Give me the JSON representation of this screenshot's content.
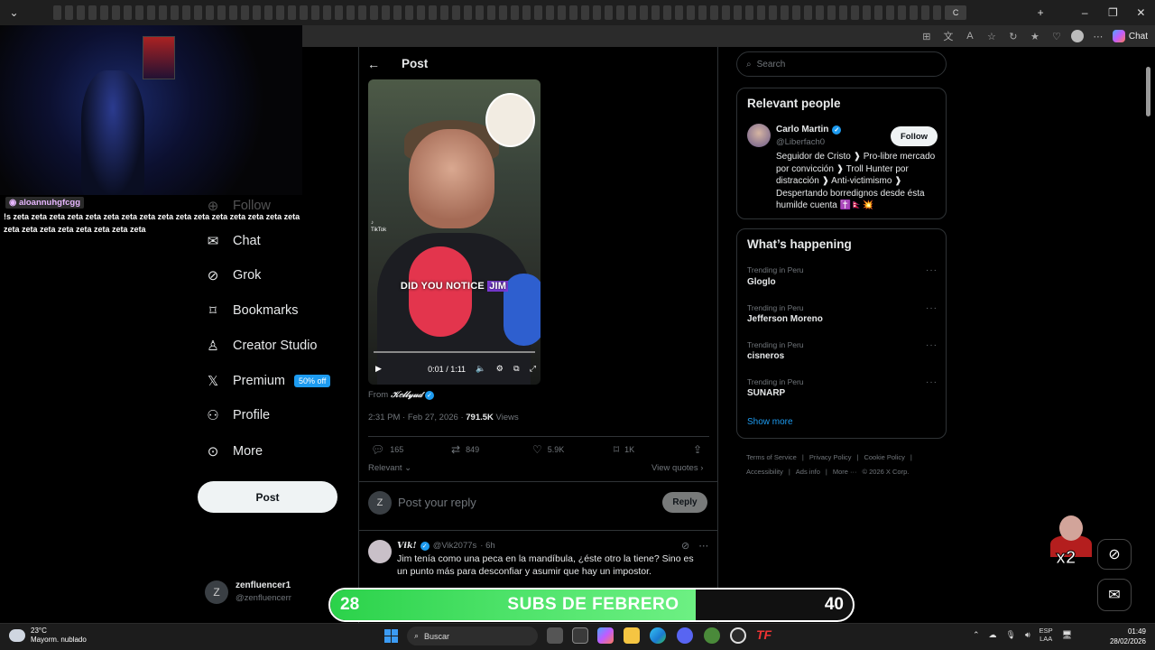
{
  "browser": {
    "active_tab_label": "C",
    "chat_label": "Chat"
  },
  "stream_overlay": {
    "chat_username": "aloannuhgfcgg",
    "chat_message": "!s zeta zeta zeta zeta zeta zeta zeta zeta zeta zeta zeta zeta zeta zeta zeta zeta zeta zeta zeta zeta zeta zeta zeta zeta",
    "subs_current": "28",
    "subs_label": "SUBS DE FEBRERO",
    "subs_goal": "40",
    "subs_progress": 0.7,
    "multiplier": "x2"
  },
  "nav": {
    "items": [
      {
        "label": "Follow",
        "icon": "add-user-icon"
      },
      {
        "label": "Chat",
        "icon": "mail-icon"
      },
      {
        "label": "Grok",
        "icon": "grok-icon"
      },
      {
        "label": "Bookmarks",
        "icon": "bookmark-icon"
      },
      {
        "label": "Creator Studio",
        "icon": "creator-icon"
      },
      {
        "label": "Premium",
        "icon": "x-logo-icon"
      },
      {
        "label": "Profile",
        "icon": "person-icon"
      },
      {
        "label": "More",
        "icon": "more-circle-icon"
      }
    ],
    "premium_badge": "50% off",
    "post_button": "Post",
    "account": {
      "avatar_letter": "Z",
      "name": "zenfluencer1",
      "handle": "@zenfluencerr"
    }
  },
  "post": {
    "header": "Post",
    "video": {
      "caption_before": "DID YOU NOTICE",
      "caption_highlight": "JIM",
      "tiktok_label": "TikTok",
      "time": "0:01 / 1:11"
    },
    "from_label": "From",
    "from_name": "𝒦𝑒𝓁𝓁𝓎𝓊𝒹",
    "timestamp": "2:31 PM · Feb 27, 2026 · ",
    "views_count": "791.5K",
    "views_label": " Views",
    "stats": {
      "replies": "165",
      "reposts": "849",
      "likes": "5.9K",
      "bookmarks": "1K"
    },
    "sort_label": "Relevant",
    "view_quotes": "View quotes",
    "reply_avatar_letter": "Z",
    "reply_placeholder": "Post your reply",
    "reply_button": "Reply",
    "comment": {
      "name": "𝑽𝒊𝒌!",
      "handle": "@Vik2077s",
      "time": "· 6h",
      "text": "Jim tenía como una peca en la mandíbula, ¿éste otro la tiene? Sino es un punto más para desconfiar y asumir que hay un impostor."
    }
  },
  "sidebar": {
    "search_placeholder": "Search",
    "relevant_title": "Relevant people",
    "person": {
      "name": "Carlo Martin",
      "handle": "@Liberfach0",
      "follow": "Follow",
      "bio": "Seguidor de Cristo ❱ Pro-libre mercado por convicción ❱ Troll Hunter por distracción ❱ Anti-victimismo ❱ Despertando borredignos desde ésta humilde cuenta ✝️🇳🇵💥"
    },
    "happening_title": "What’s happening",
    "trends": [
      {
        "context": "Trending in Peru",
        "name": "Gloglo"
      },
      {
        "context": "Trending in Peru",
        "name": "Jefferson Moreno"
      },
      {
        "context": "Trending in Peru",
        "name": "cisneros"
      },
      {
        "context": "Trending in Peru",
        "name": "SUNARP"
      }
    ],
    "show_more": "Show more",
    "footer": [
      "Terms of Service",
      "|",
      "Privacy Policy",
      "|",
      "Cookie Policy",
      "|",
      "Accessibility",
      "|",
      "Ads info",
      "|",
      "More ···",
      "© 2026 X Corp."
    ]
  },
  "taskbar": {
    "temperature": "23°C",
    "weather_desc": "Mayorm. nublado",
    "search_label": "Buscar",
    "lang_top": "ESP",
    "lang_bottom": "LAA",
    "time": "01:49",
    "date": "28/02/2026"
  },
  "colors": {
    "accent": "#1d9bf0",
    "subs_green": "#3ddc5a",
    "bg": "#000000"
  }
}
